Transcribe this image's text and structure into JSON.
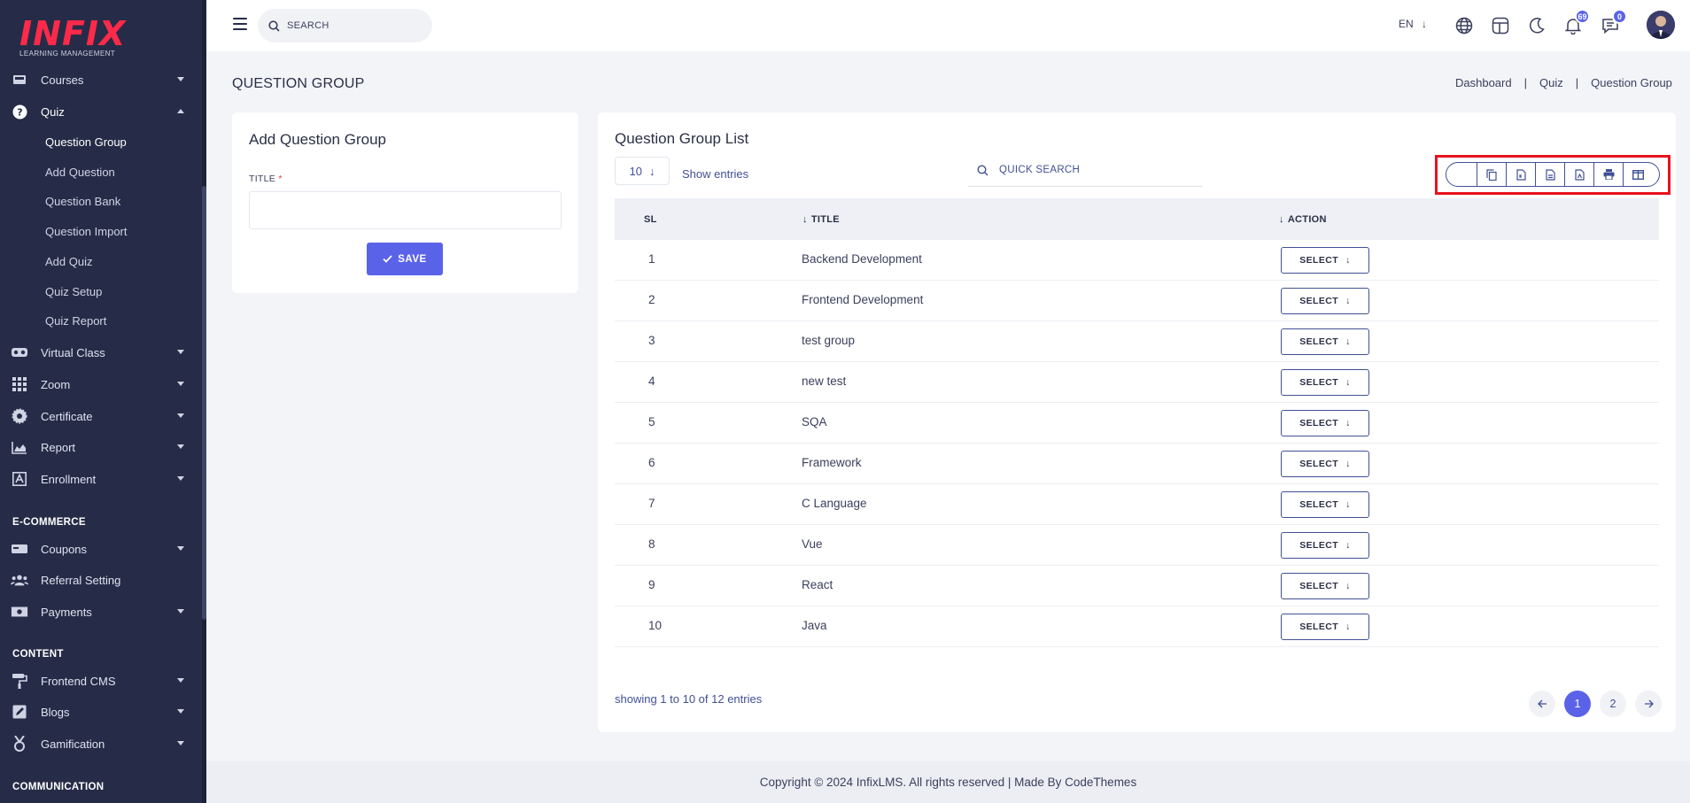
{
  "brand": {
    "logo_word": "INFIX",
    "logo_tagline": "LEARNING MANAGEMENT"
  },
  "sidebar": {
    "items": [
      {
        "label": "Courses",
        "icon": "courses-icon"
      },
      {
        "label": "Quiz",
        "icon": "question-circle-icon",
        "expanded": true
      },
      {
        "label": "Virtual Class",
        "icon": "vr-headset-icon"
      },
      {
        "label": "Zoom",
        "icon": "grid-icon"
      },
      {
        "label": "Certificate",
        "icon": "certificate-icon"
      },
      {
        "label": "Report",
        "icon": "area-chart-icon"
      },
      {
        "label": "Enrollment",
        "icon": "enrollment-icon"
      }
    ],
    "quiz_sub": [
      {
        "label": "Question Group",
        "active": true
      },
      {
        "label": "Add Question"
      },
      {
        "label": "Question Bank"
      },
      {
        "label": "Question Import"
      },
      {
        "label": "Add Quiz"
      },
      {
        "label": "Quiz Setup"
      },
      {
        "label": "Quiz Report"
      }
    ],
    "sections": {
      "ecommerce": "E-COMMERCE",
      "content": "CONTENT",
      "communication": "COMMUNICATION"
    },
    "ecommerce_items": [
      {
        "label": "Coupons",
        "icon": "coupon-icon"
      },
      {
        "label": "Referral Setting",
        "icon": "users-icon"
      },
      {
        "label": "Payments",
        "icon": "money-icon"
      }
    ],
    "content_items": [
      {
        "label": "Frontend CMS",
        "icon": "paint-roller-icon"
      },
      {
        "label": "Blogs",
        "icon": "edit-icon"
      },
      {
        "label": "Gamification",
        "icon": "medal-icon"
      }
    ]
  },
  "topbar": {
    "search_placeholder": "SEARCH",
    "language": "EN",
    "notifications_count": "69",
    "messages_count": "0"
  },
  "page": {
    "title": "QUESTION GROUP",
    "breadcrumb": [
      "Dashboard",
      "Quiz",
      "Question Group"
    ],
    "breadcrumb_sep": "|"
  },
  "add_form": {
    "heading": "Add Question Group",
    "title_label": "TITLE",
    "required_mark": "*",
    "title_value": "",
    "save_label": "SAVE"
  },
  "list": {
    "heading": "Question Group List",
    "entries_value": "10",
    "show_entries_label": "Show entries",
    "quick_search_placeholder": "QUICK SEARCH",
    "columns": {
      "sl": "SL",
      "title": "TITLE",
      "action": "ACTION"
    },
    "select_label": "SELECT",
    "rows": [
      {
        "sl": "1",
        "title": "Backend Development"
      },
      {
        "sl": "2",
        "title": "Frontend Development"
      },
      {
        "sl": "3",
        "title": "test group"
      },
      {
        "sl": "4",
        "title": "new test"
      },
      {
        "sl": "5",
        "title": "SQA"
      },
      {
        "sl": "6",
        "title": "Framework"
      },
      {
        "sl": "7",
        "title": "C Language"
      },
      {
        "sl": "8",
        "title": "Vue"
      },
      {
        "sl": "9",
        "title": "React"
      },
      {
        "sl": "10",
        "title": "Java"
      }
    ],
    "export_buttons": [
      "copy-icon",
      "csv-icon",
      "excel-icon",
      "pdf-icon",
      "print-icon",
      "columns-icon"
    ],
    "showing_text": "showing 1 to 10 of 12 entries",
    "pages": [
      "1",
      "2"
    ],
    "current_page": "1"
  },
  "footer": {
    "text": "Copyright © 2024 InfixLMS. All rights reserved | Made By CodeThemes"
  },
  "colors": {
    "accent": "#5a63e8",
    "sidebar_bg": "#262c47",
    "highlight": "#e8121e",
    "text": "#415094"
  }
}
